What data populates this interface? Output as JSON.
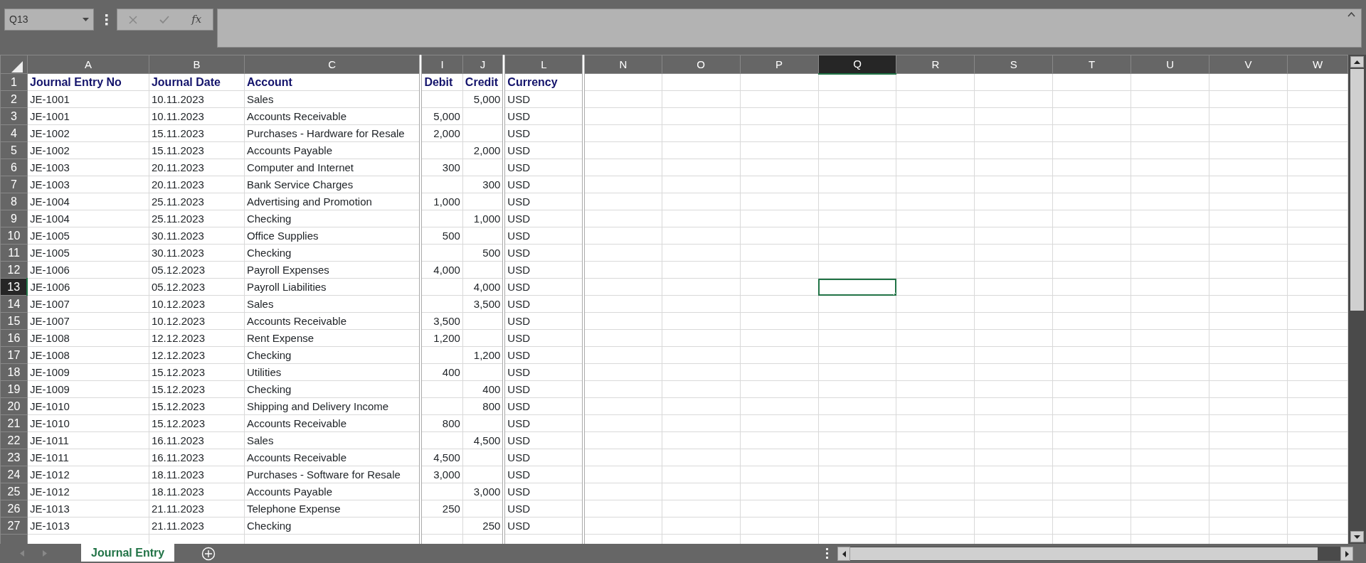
{
  "name_box": "Q13",
  "formula_bar": {
    "function_label": "fx"
  },
  "columns": [
    {
      "letter": "A",
      "selected": false,
      "hidden_before": false
    },
    {
      "letter": "B",
      "selected": false,
      "hidden_before": false
    },
    {
      "letter": "C",
      "selected": false,
      "hidden_before": false
    },
    {
      "letter": "I",
      "selected": false,
      "hidden_before": true
    },
    {
      "letter": "J",
      "selected": false,
      "hidden_before": false
    },
    {
      "letter": "L",
      "selected": false,
      "hidden_before": true
    },
    {
      "letter": "N",
      "selected": false,
      "hidden_before": true
    },
    {
      "letter": "O",
      "selected": false,
      "hidden_before": false
    },
    {
      "letter": "P",
      "selected": false,
      "hidden_before": false
    },
    {
      "letter": "Q",
      "selected": true,
      "hidden_before": false
    },
    {
      "letter": "R",
      "selected": false,
      "hidden_before": false
    },
    {
      "letter": "S",
      "selected": false,
      "hidden_before": false
    },
    {
      "letter": "T",
      "selected": false,
      "hidden_before": false
    },
    {
      "letter": "U",
      "selected": false,
      "hidden_before": false
    },
    {
      "letter": "V",
      "selected": false,
      "hidden_before": false
    },
    {
      "letter": "W",
      "selected": false,
      "hidden_before": false
    }
  ],
  "rows": [
    {
      "number": "1",
      "selected": false,
      "kind": "header",
      "cells": {
        "A": "Journal Entry No",
        "B": "Journal Date",
        "C": "Account",
        "I": "Debit",
        "J": "Credit",
        "L": "Currency"
      }
    },
    {
      "number": "2",
      "selected": false,
      "kind": "data",
      "cells": {
        "A": "JE-1001",
        "B": "10.11.2023",
        "C": "Sales",
        "J": "5,000",
        "L": "USD"
      }
    },
    {
      "number": "3",
      "selected": false,
      "kind": "data",
      "cells": {
        "A": "JE-1001",
        "B": "10.11.2023",
        "C": "Accounts Receivable",
        "I": "5,000",
        "L": "USD"
      }
    },
    {
      "number": "4",
      "selected": false,
      "kind": "data",
      "cells": {
        "A": "JE-1002",
        "B": "15.11.2023",
        "C": "Purchases - Hardware for Resale",
        "I": "2,000",
        "L": "USD"
      }
    },
    {
      "number": "5",
      "selected": false,
      "kind": "data",
      "cells": {
        "A": "JE-1002",
        "B": "15.11.2023",
        "C": "Accounts Payable",
        "J": "2,000",
        "L": "USD"
      }
    },
    {
      "number": "6",
      "selected": false,
      "kind": "data",
      "cells": {
        "A": "JE-1003",
        "B": "20.11.2023",
        "C": "Computer and Internet",
        "I": "300",
        "L": "USD"
      }
    },
    {
      "number": "7",
      "selected": false,
      "kind": "data",
      "cells": {
        "A": "JE-1003",
        "B": "20.11.2023",
        "C": "Bank Service Charges",
        "J": "300",
        "L": "USD"
      }
    },
    {
      "number": "8",
      "selected": false,
      "kind": "data",
      "cells": {
        "A": "JE-1004",
        "B": "25.11.2023",
        "C": "Advertising and Promotion",
        "I": "1,000",
        "L": "USD"
      }
    },
    {
      "number": "9",
      "selected": false,
      "kind": "data",
      "cells": {
        "A": "JE-1004",
        "B": "25.11.2023",
        "C": "Checking",
        "J": "1,000",
        "L": "USD"
      }
    },
    {
      "number": "10",
      "selected": false,
      "kind": "data",
      "cells": {
        "A": "JE-1005",
        "B": "30.11.2023",
        "C": "Office Supplies",
        "I": "500",
        "L": "USD"
      }
    },
    {
      "number": "11",
      "selected": false,
      "kind": "data",
      "cells": {
        "A": "JE-1005",
        "B": "30.11.2023",
        "C": "Checking",
        "J": "500",
        "L": "USD"
      }
    },
    {
      "number": "12",
      "selected": false,
      "kind": "data",
      "cells": {
        "A": "JE-1006",
        "B": "05.12.2023",
        "C": "Payroll Expenses",
        "I": "4,000",
        "L": "USD"
      }
    },
    {
      "number": "13",
      "selected": true,
      "kind": "data",
      "cells": {
        "A": "JE-1006",
        "B": "05.12.2023",
        "C": "Payroll Liabilities",
        "J": "4,000",
        "L": "USD"
      }
    },
    {
      "number": "14",
      "selected": false,
      "kind": "data",
      "cells": {
        "A": "JE-1007",
        "B": "10.12.2023",
        "C": "Sales",
        "J": "3,500",
        "L": "USD"
      }
    },
    {
      "number": "15",
      "selected": false,
      "kind": "data",
      "cells": {
        "A": "JE-1007",
        "B": "10.12.2023",
        "C": "Accounts Receivable",
        "I": "3,500",
        "L": "USD"
      }
    },
    {
      "number": "16",
      "selected": false,
      "kind": "data",
      "cells": {
        "A": "JE-1008",
        "B": "12.12.2023",
        "C": "Rent Expense",
        "I": "1,200",
        "L": "USD"
      }
    },
    {
      "number": "17",
      "selected": false,
      "kind": "data",
      "cells": {
        "A": "JE-1008",
        "B": "12.12.2023",
        "C": "Checking",
        "J": "1,200",
        "L": "USD"
      }
    },
    {
      "number": "18",
      "selected": false,
      "kind": "data",
      "cells": {
        "A": "JE-1009",
        "B": "15.12.2023",
        "C": "Utilities",
        "I": "400",
        "L": "USD"
      }
    },
    {
      "number": "19",
      "selected": false,
      "kind": "data",
      "cells": {
        "A": "JE-1009",
        "B": "15.12.2023",
        "C": "Checking",
        "J": "400",
        "L": "USD"
      }
    },
    {
      "number": "20",
      "selected": false,
      "kind": "data",
      "cells": {
        "A": "JE-1010",
        "B": "15.12.2023",
        "C": "Shipping and Delivery Income",
        "J": "800",
        "L": "USD"
      }
    },
    {
      "number": "21",
      "selected": false,
      "kind": "data",
      "cells": {
        "A": "JE-1010",
        "B": "15.12.2023",
        "C": "Accounts Receivable",
        "I": "800",
        "L": "USD"
      }
    },
    {
      "number": "22",
      "selected": false,
      "kind": "data",
      "cells": {
        "A": "JE-1011",
        "B": "16.11.2023",
        "C": "Sales",
        "J": "4,500",
        "L": "USD"
      }
    },
    {
      "number": "23",
      "selected": false,
      "kind": "data",
      "cells": {
        "A": "JE-1011",
        "B": "16.11.2023",
        "C": "Accounts Receivable",
        "I": "4,500",
        "L": "USD"
      }
    },
    {
      "number": "24",
      "selected": false,
      "kind": "data",
      "cells": {
        "A": "JE-1012",
        "B": "18.11.2023",
        "C": "Purchases - Software for Resale",
        "I": "3,000",
        "L": "USD"
      }
    },
    {
      "number": "25",
      "selected": false,
      "kind": "data",
      "cells": {
        "A": "JE-1012",
        "B": "18.11.2023",
        "C": "Accounts Payable",
        "J": "3,000",
        "L": "USD"
      }
    },
    {
      "number": "26",
      "selected": false,
      "kind": "data",
      "cells": {
        "A": "JE-1013",
        "B": "21.11.2023",
        "C": "Telephone Expense",
        "I": "250",
        "L": "USD"
      }
    },
    {
      "number": "27",
      "selected": false,
      "kind": "data",
      "cells": {
        "A": "JE-1013",
        "B": "21.11.2023",
        "C": "Checking",
        "J": "250",
        "L": "USD"
      }
    }
  ],
  "sheet_tabs": [
    {
      "label": "Journal Entry",
      "selected": true
    }
  ]
}
